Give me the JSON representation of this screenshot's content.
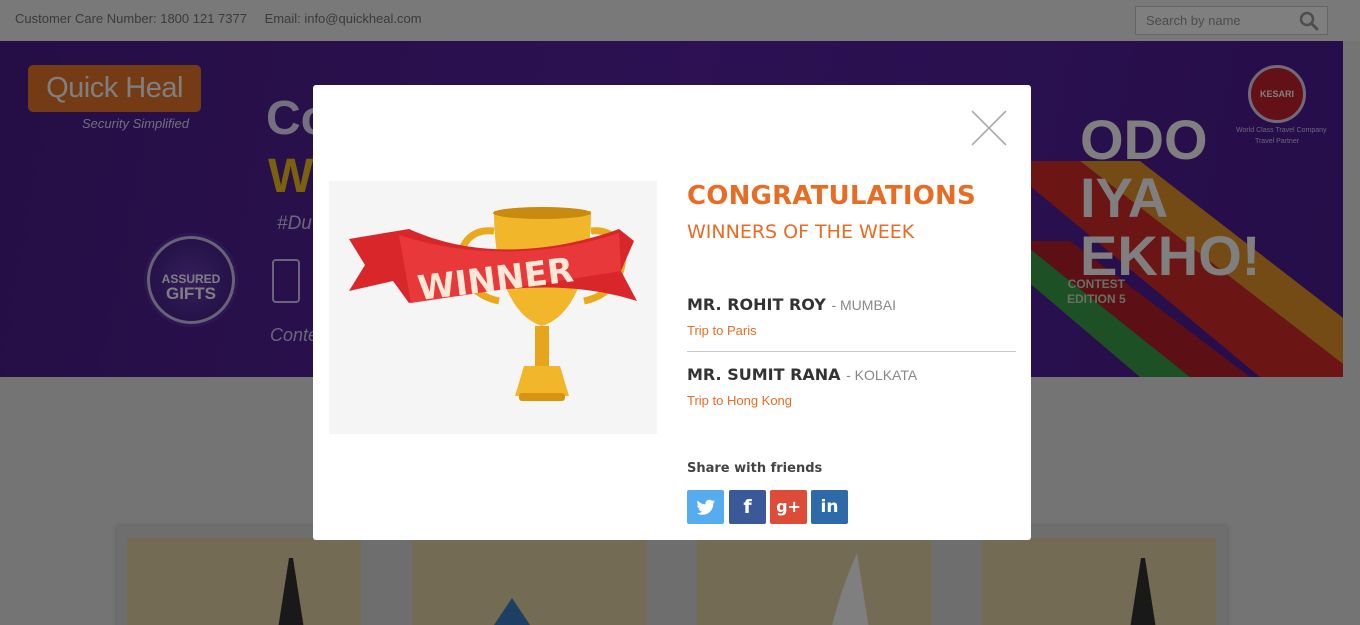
{
  "topbar": {
    "care_number": "Customer Care Number: 1800 121 7377",
    "email": "Email: info@quickheal.com",
    "search_placeholder": "Search by name"
  },
  "banner": {
    "logo": "Quick Heal",
    "logo_tagline": "Security Simplified",
    "headline_1": "Co",
    "headline_2": "W",
    "hashtag": "#Du",
    "contest_link": "Conte",
    "badge_line1": "ASSURED",
    "badge_line2": "GIFTS",
    "title": "ODO\nIYA\nEKHO!",
    "contest": "CONTEST\nEDITION 5",
    "partner_logo": "KESARI",
    "partner_tagline": "World Class Travel Company\nTravel Partner"
  },
  "modal": {
    "trophy_ribbon": "WINNER",
    "title": "CONGRATULATIONS",
    "subtitle": "WINNERS OF THE WEEK",
    "winners": [
      {
        "name": "MR. ROHIT ROY",
        "city": "- MUMBAI",
        "prize": "Trip to Paris"
      },
      {
        "name": "MR. SUMIT RANA",
        "city": "- KOLKATA",
        "prize": "Trip to Hong Kong"
      }
    ],
    "share_label": "Share with friends",
    "share_buttons": [
      {
        "name": "twitter",
        "icon": "twitter-icon"
      },
      {
        "name": "facebook",
        "icon": "facebook-icon",
        "glyph": "f"
      },
      {
        "name": "google-plus",
        "icon": "google-plus-icon",
        "glyph": "g+"
      },
      {
        "name": "linkedin",
        "icon": "linkedin-icon",
        "glyph": "in"
      }
    ]
  },
  "colors": {
    "accent": "#e86c24",
    "twitter": "#55acee",
    "facebook": "#3b5998",
    "google_plus": "#dd4b39",
    "linkedin": "#2e6aa8"
  }
}
